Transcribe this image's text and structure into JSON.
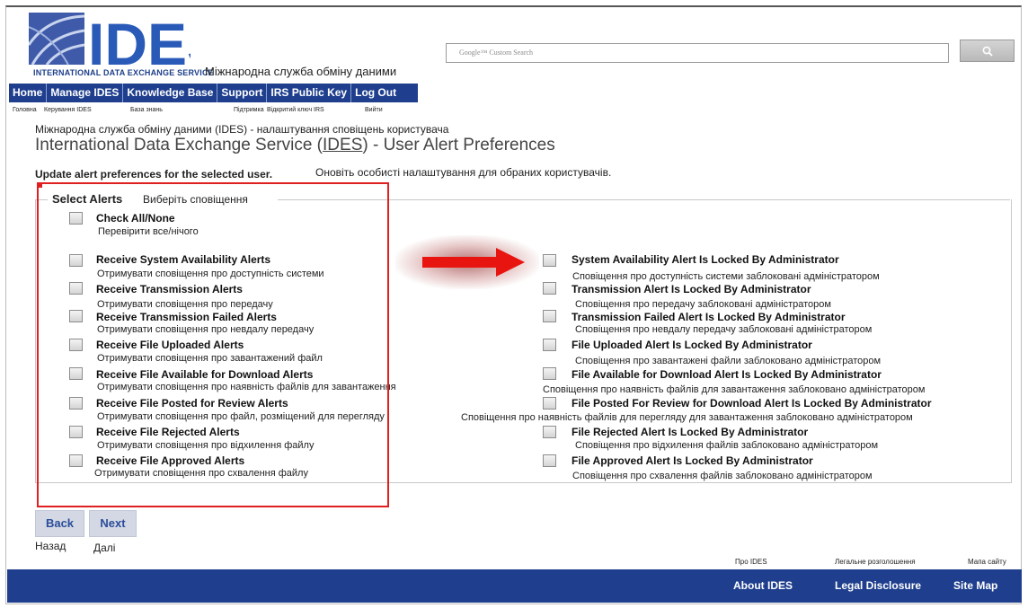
{
  "header": {
    "logo_text": "INTERNATIONAL DATA EXCHANGE SERVICE",
    "logo_mark": "IDES",
    "logo_uk": "Міжнародна служба обміну даними",
    "search_placeholder": "Google™ Custom Search"
  },
  "nav": {
    "items": [
      "Home",
      "Manage IDES",
      "Knowledge Base",
      "Support",
      "IRS Public Key",
      "Log Out"
    ],
    "uk": [
      "Головна",
      "Керування IDES",
      "База знань",
      "Підтримка",
      "Відкритий ключ IRS",
      "Вийти"
    ]
  },
  "page": {
    "title_uk": "Міжнародна служба обміну даними (IDES) - налаштування сповіщень користувача",
    "title_pre": "International Data Exchange Service (",
    "title_ides": "IDES",
    "title_post": ") - User Alert Preferences",
    "subtitle": "Update alert preferences for the selected user.",
    "subtitle_uk": "Оновіть особисті налаштування для обраних користувачів."
  },
  "alerts": {
    "legend": "Select Alerts",
    "legend_uk": "Виберіть сповіщення",
    "check_all": {
      "label": "Check All/None",
      "uk": "Перевірити все/нічого"
    },
    "left": [
      {
        "label": "Receive System Availability Alerts",
        "uk": "Отримувати сповіщення про доступність системи"
      },
      {
        "label": "Receive Transmission Alerts",
        "uk": "Отримувати сповіщення про передачу"
      },
      {
        "label": "Receive Transmission Failed Alerts",
        "uk": "Отримувати сповіщення про невдалу передачу"
      },
      {
        "label": "Receive File Uploaded Alerts",
        "uk": "Отримувати сповіщення про завантажений файл"
      },
      {
        "label": "Receive File Available for Download Alerts",
        "uk": "Отримувати сповіщення про наявність файлів для завантаження"
      },
      {
        "label": "Receive File Posted for Review Alerts",
        "uk": "Отримувати сповіщення про файл, розміщений для перегляду"
      },
      {
        "label": "Receive File Rejected Alerts",
        "uk": "Отримувати сповіщення про відхилення файлу"
      },
      {
        "label": "Receive File Approved Alerts",
        "uk": "Отримувати сповіщення про схвалення файлу"
      }
    ],
    "right": [
      {
        "label": "System Availability Alert Is Locked By Administrator",
        "uk": "Сповіщення про доступність системи заблоковані адміністратором"
      },
      {
        "label": "Transmission Alert Is Locked By Administrator",
        "uk": "Сповіщення про передачу заблоковані адміністратором"
      },
      {
        "label": "Transmission Failed Alert Is Locked By Administrator",
        "uk": "Сповіщення про невдалу передачу заблоковані адміністратором"
      },
      {
        "label": "File Uploaded Alert Is Locked By Administrator",
        "uk": "Сповіщення про завантажені файли заблоковано адміністратором"
      },
      {
        "label": "File Available for Download Alert Is Locked By Administrator",
        "uk": "Сповіщення про наявність файлів для завантаження заблоковано адміністратором"
      },
      {
        "label": "File Posted For Review for Download Alert Is Locked By Administrator",
        "uk": "Сповіщення про наявність файлів для перегляду для завантаження заблоковано адміністратором"
      },
      {
        "label": "File Rejected Alert Is Locked By Administrator",
        "uk": "Сповіщення про відхилення файлів заблоковано адміністратором"
      },
      {
        "label": "File Approved Alert Is Locked By Administrator",
        "uk": "Сповіщення про схвалення файлів заблоковано адміністратором"
      }
    ]
  },
  "buttons": {
    "back": "Back",
    "next": "Next",
    "back_uk": "Назад",
    "next_uk": "Далі"
  },
  "footer": {
    "about": "About IDES",
    "legal": "Legal Disclosure",
    "sitemap": "Site Map",
    "about_uk": "Про IDES",
    "legal_uk": "Легальне розголошення",
    "sitemap_uk": "Мапа сайту"
  },
  "colors": {
    "nav_bg": "#1f3f8e",
    "annotation_red": "#e02020"
  }
}
